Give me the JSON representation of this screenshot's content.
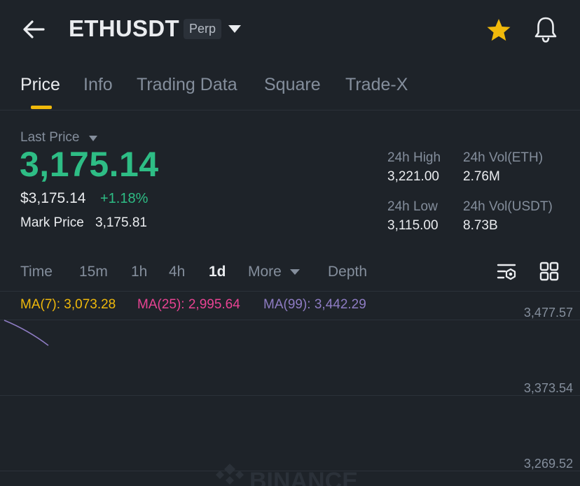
{
  "header": {
    "symbol": "ETHUSDT",
    "contract_type": "Perp",
    "icons": [
      "back-arrow-icon",
      "dropdown-caret-icon",
      "star-icon",
      "bell-icon"
    ]
  },
  "tabs": [
    {
      "label": "Price",
      "active": true
    },
    {
      "label": "Info"
    },
    {
      "label": "Trading Data"
    },
    {
      "label": "Square"
    },
    {
      "label": "Trade-X"
    }
  ],
  "price": {
    "last_price_label": "Last Price",
    "last_price": "3,175.14",
    "usd_price": "$3,175.14",
    "change_pct": "+1.18%",
    "mark_price_label": "Mark Price",
    "mark_price": "3,175.81"
  },
  "stats": {
    "high_label": "24h High",
    "high": "3,221.00",
    "low_label": "24h Low",
    "low": "3,115.00",
    "vol_eth_label": "24h Vol(ETH)",
    "vol_eth": "2.76M",
    "vol_usdt_label": "24h Vol(USDT)",
    "vol_usdt": "8.73B"
  },
  "intervals": {
    "items": [
      "Time",
      "15m",
      "1h",
      "4h",
      "1d",
      "More",
      "Depth"
    ],
    "selected": "1d"
  },
  "chart": {
    "ma7": "MA(7): 3,073.28",
    "ma25": "MA(25): 2,995.64",
    "ma99": "MA(99): 3,442.29",
    "axis_labels": [
      "3,477.57",
      "3,373.54",
      "3,269.52"
    ],
    "watermark": "BINANCE"
  },
  "colors": {
    "background": "#1e2329",
    "up_green": "#2ebd85",
    "accent_yellow": "#f0b90b",
    "ma7": "#f0b90b",
    "ma25": "#e84393",
    "ma99": "#8e7cc3",
    "muted_text": "#848e9c"
  }
}
